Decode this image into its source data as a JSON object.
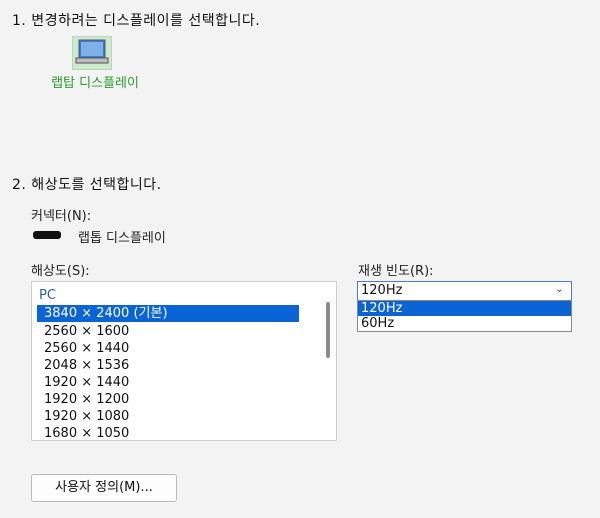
{
  "step1": {
    "title": "1. 변경하려는 디스플레이를 선택합니다."
  },
  "display": {
    "name": "랩탑 디스플레이",
    "icon": "laptop-icon",
    "name_color": "#2b9b2b"
  },
  "step2": {
    "title": "2. 해상도를 선택합니다."
  },
  "connector": {
    "label": "커넥터(N):",
    "value": "랩톱 디스플레이",
    "icon": "connector-icon"
  },
  "resolution": {
    "label": "해상도(S):",
    "group": "PC",
    "items": [
      "3840 × 2400 (기본)",
      "2560 × 1600",
      "2560 × 1440",
      "2048 × 1536",
      "1920 × 1440",
      "1920 × 1200",
      "1920 × 1080",
      "1680 × 1050"
    ],
    "selected_index": 0
  },
  "refresh": {
    "label": "재생 빈도(R):",
    "value": "120Hz",
    "options": [
      "120Hz",
      "60Hz"
    ],
    "selected_index": 0
  },
  "custom_button": {
    "label": "사용자 정의(M)..."
  },
  "colors": {
    "accent": "#0a64d6",
    "background": "#f3f3f3"
  }
}
